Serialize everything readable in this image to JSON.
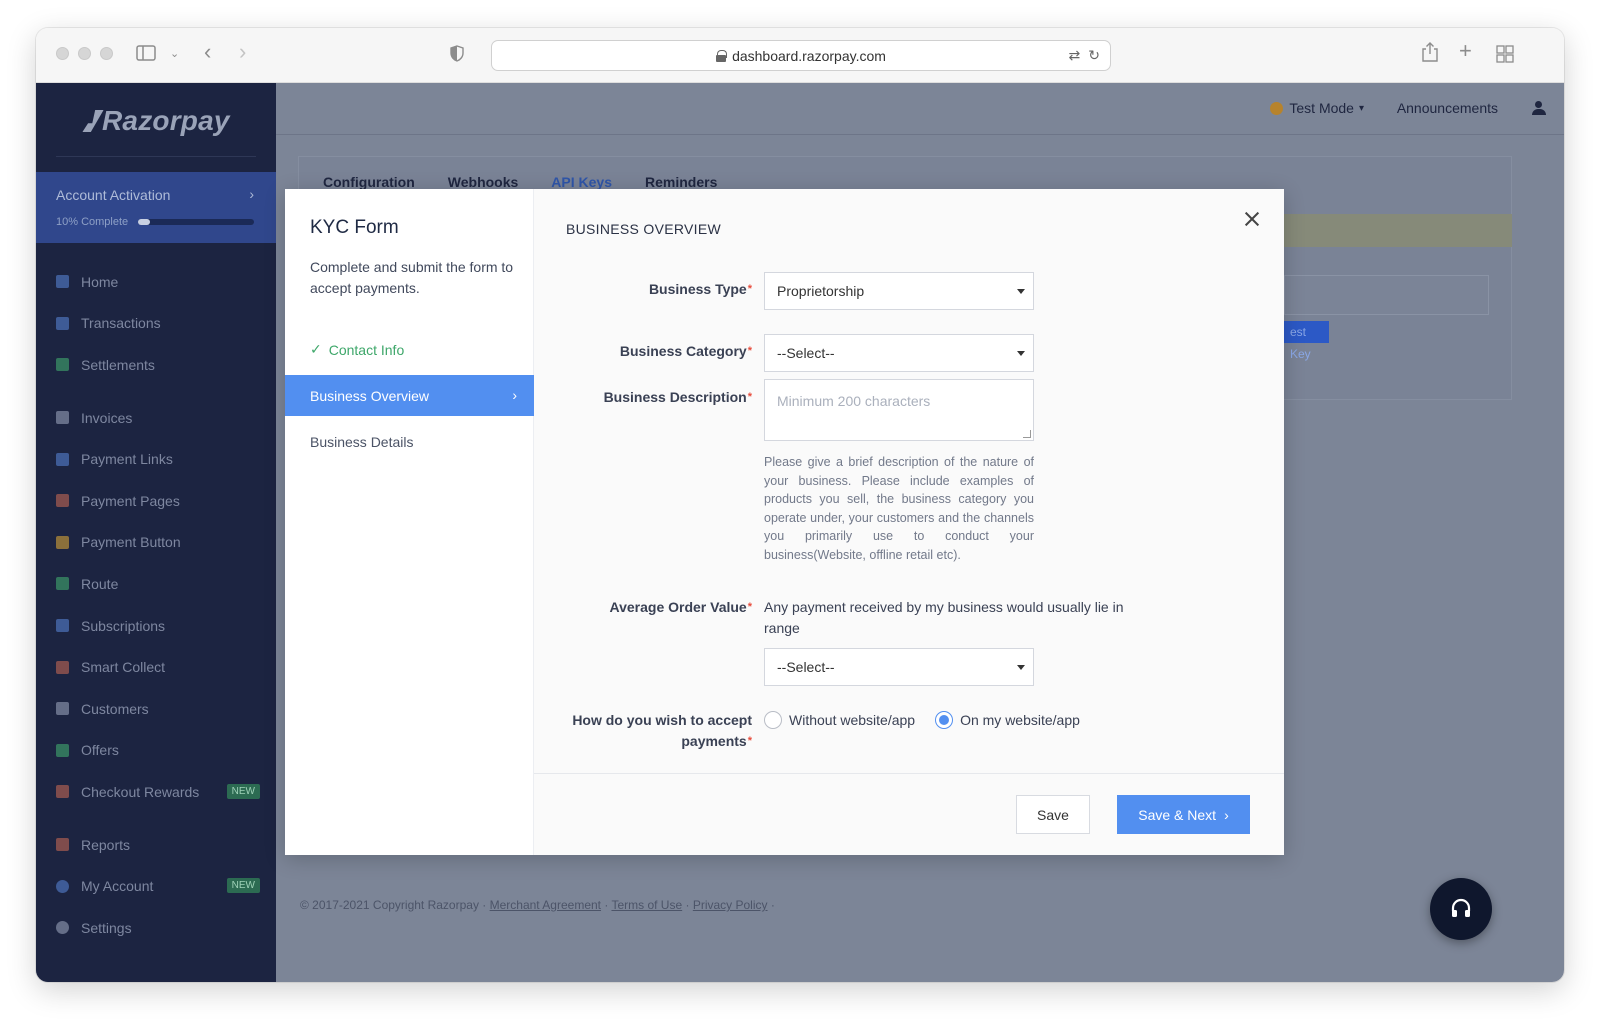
{
  "browser": {
    "url": "dashboard.razorpay.com"
  },
  "sidebar": {
    "logo": "Razorpay",
    "activation": {
      "title": "Account Activation",
      "progress_label": "10% Complete",
      "progress": 0.1
    },
    "items": [
      {
        "label": "Home",
        "icon": "home-icon"
      },
      {
        "label": "Transactions",
        "icon": "transactions-icon"
      },
      {
        "label": "Settlements",
        "icon": "settlements-icon"
      },
      {
        "label": "Invoices",
        "icon": "invoice-icon"
      },
      {
        "label": "Payment Links",
        "icon": "link-icon"
      },
      {
        "label": "Payment Pages",
        "icon": "page-icon"
      },
      {
        "label": "Payment Button",
        "icon": "button-icon"
      },
      {
        "label": "Route",
        "icon": "route-icon"
      },
      {
        "label": "Subscriptions",
        "icon": "subscriptions-icon"
      },
      {
        "label": "Smart Collect",
        "icon": "bank-icon"
      },
      {
        "label": "Customers",
        "icon": "customers-icon"
      },
      {
        "label": "Offers",
        "icon": "tag-icon"
      },
      {
        "label": "Checkout Rewards",
        "icon": "gift-icon",
        "badge": "NEW"
      },
      {
        "label": "Reports",
        "icon": "reports-icon"
      },
      {
        "label": "My Account",
        "icon": "account-icon",
        "badge": "NEW"
      },
      {
        "label": "Settings",
        "icon": "gear-icon"
      }
    ]
  },
  "topbar": {
    "mode": "Test Mode",
    "announcements": "Announcements"
  },
  "settings_tabs": [
    "Configuration",
    "Webhooks",
    "API Keys",
    "Reminders"
  ],
  "background": {
    "key_button": "est Key"
  },
  "footer": {
    "copyright": "© 2017-2021 Copyright Razorpay · ",
    "links": [
      "Merchant Agreement",
      "Terms of Use",
      "Privacy Policy"
    ]
  },
  "modal": {
    "title": "KYC Form",
    "description": "Complete and submit the form to accept payments.",
    "steps": [
      {
        "label": "Contact Info",
        "state": "done"
      },
      {
        "label": "Business Overview",
        "state": "active"
      },
      {
        "label": "Business Details",
        "state": "pending"
      }
    ],
    "section_title": "BUSINESS OVERVIEW",
    "fields": {
      "business_type": {
        "label": "Business Type",
        "value": "Proprietorship"
      },
      "business_category": {
        "label": "Business Category",
        "value": "--Select--"
      },
      "business_description": {
        "label": "Business Description",
        "placeholder": "Minimum 200 characters",
        "help": "Please give a brief description of the nature of your business. Please include examples of products you sell, the business category you operate under, your customers and the channels you primarily use to conduct your business(Website, offline retail etc)."
      },
      "average_order_value": {
        "label": "Average Order Value",
        "text": "Any payment received by my business would usually lie in range",
        "value": "--Select--"
      },
      "accept_payments": {
        "label": "How do you wish to accept payments",
        "options": [
          "Without website/app",
          "On my website/app"
        ],
        "selected": "On my website/app"
      }
    },
    "buttons": {
      "save": "Save",
      "save_next": "Save & Next"
    }
  },
  "colors": {
    "primary": "#528ff0",
    "success": "#3ea76a",
    "sidebar": "#1c2441",
    "required": "#e74c3c"
  }
}
